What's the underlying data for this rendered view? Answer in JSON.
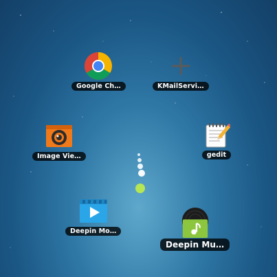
{
  "desktop": {
    "apps": [
      {
        "id": "chrome",
        "label": "Google Ch…",
        "icon": "chrome-icon"
      },
      {
        "id": "kmail",
        "label": "KMailServi…",
        "icon": "plus-icon"
      },
      {
        "id": "imageviewer",
        "label": "Image Vie…",
        "icon": "image-viewer-icon"
      },
      {
        "id": "gedit",
        "label": "gedit",
        "icon": "notepad-icon"
      },
      {
        "id": "deepin-movie",
        "label": "Deepin Mo…",
        "icon": "video-player-icon"
      },
      {
        "id": "deepin-music",
        "label": "Deepin Mu…",
        "icon": "music-player-icon"
      }
    ],
    "loading_indicator": {
      "icon": "loading-dots-icon"
    }
  },
  "colors": {
    "background_top": "#133f66",
    "background_center": "#5fa8cc",
    "label_bg": "#000000",
    "loading_accent": "#b5e655"
  }
}
